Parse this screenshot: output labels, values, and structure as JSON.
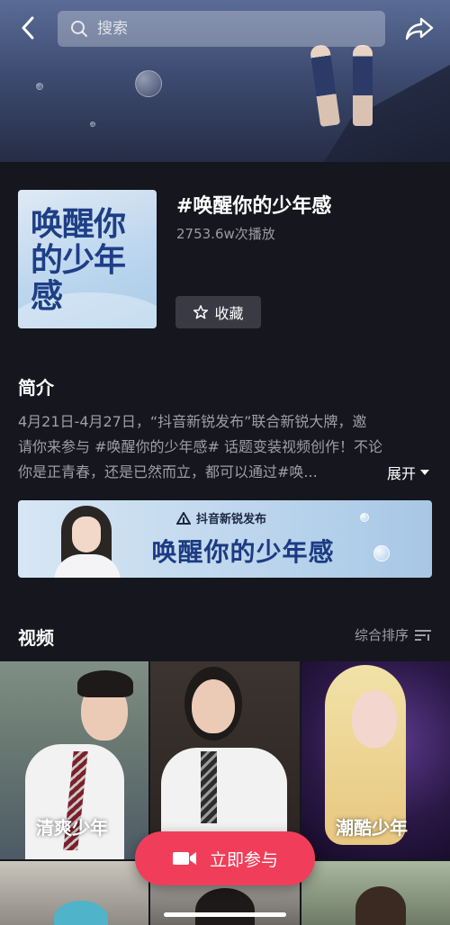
{
  "header": {
    "search_placeholder": "搜索",
    "icons": {
      "back": "chevron-left-icon",
      "search": "search-icon",
      "share": "share-arrow-icon"
    }
  },
  "topic": {
    "title": "#唤醒你的少年感",
    "play_count": "2753.6w次播放",
    "cover_text": "唤醒你的少年感",
    "collect_label": "收藏",
    "collect_icon": "star-outline-icon"
  },
  "intro": {
    "heading": "简介",
    "lines": [
      "4月21日-4月27日，“抖音新锐发布”联合新锐大牌，邀",
      "请你来参与 #唤醒你的少年感# 话题变装视频创作！不论",
      "你是正青春，还是已然而立，都可以通过#唤..."
    ],
    "expand_label": "展开"
  },
  "promo": {
    "brand": "抖音新锐发布",
    "slogan": "唤醒你的少年感"
  },
  "videos": {
    "heading": "视频",
    "sort_label": "综合排序",
    "thumbnails": [
      {
        "caption": "清爽少年"
      },
      {
        "caption": ""
      },
      {
        "caption": "潮酷少年"
      }
    ]
  },
  "join_button": {
    "label": "立即参与",
    "icon": "video-camera-icon"
  },
  "colors": {
    "accent": "#f03e5a",
    "background": "#15161e",
    "secondary_text": "#9d9ea6"
  }
}
